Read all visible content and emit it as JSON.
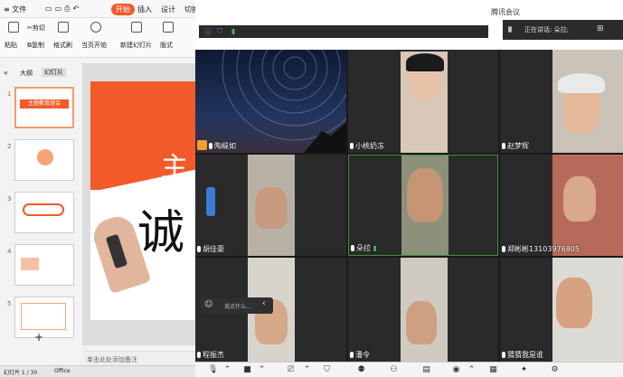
{
  "wps": {
    "menu": {
      "file": "文件",
      "start_tab": "开始",
      "insert": "插入",
      "design": "设计",
      "switch": "切换"
    },
    "ribbon": {
      "paste": "粘贴",
      "cut": "剪切",
      "copy": "复制",
      "format_painter": "格式刷",
      "play_from_current": "当页开始",
      "new_slide": "新建幻灯片",
      "layout": "版式"
    },
    "panel_tabs": {
      "outline": "大纲",
      "slides": "幻灯片"
    },
    "slides": [
      {
        "num": "1",
        "title": "主题教育班会"
      },
      {
        "num": "2",
        "title": ""
      },
      {
        "num": "3",
        "title": ""
      },
      {
        "num": "4",
        "title": ""
      },
      {
        "num": "5",
        "title": ""
      }
    ],
    "slide_main": {
      "char1": "主",
      "char2": "诚"
    },
    "notes_placeholder": "单击此处添加备注",
    "add_slide": "+",
    "status": {
      "page": "幻灯片 1 / 30",
      "theme": "Office"
    }
  },
  "meeting": {
    "app_name": "腾讯会议",
    "speaking_label": "正在讲话: 朵拉;",
    "participants": [
      {
        "name": "陶缇如"
      },
      {
        "name": "小桃奶冻"
      },
      {
        "name": "赵梦辉"
      },
      {
        "name": "胡佳豪"
      },
      {
        "name": "朵拉"
      },
      {
        "name": "郑彬彬13103976805"
      },
      {
        "name": "程振杰"
      },
      {
        "name": "潘令"
      },
      {
        "name": "猜猜我是谁"
      }
    ],
    "chat_placeholder": "说点什么..."
  },
  "colors": {
    "accent": "#f25a2a",
    "active_border": "#3f8f3f"
  }
}
